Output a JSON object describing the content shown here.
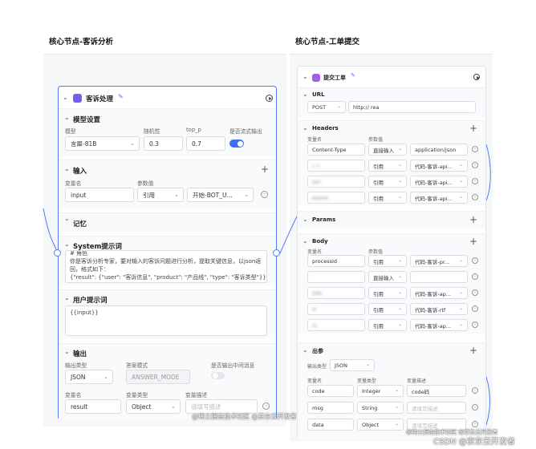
{
  "columns": {
    "left_title": "核心节点-客诉分析",
    "right_title": "核心节点-工单提交"
  },
  "left_node": {
    "title": "客诉处理",
    "model": {
      "section": "模型设置",
      "model_label": "模型",
      "model_value": "言犀-81B",
      "temp_label": "随机性",
      "temp_value": "0.3",
      "topp_label": "top_p",
      "topp_value": "0.7",
      "stream_label": "是否流式输出"
    },
    "input": {
      "section": "输入",
      "name_label": "变量名",
      "value_label": "参数值",
      "name": "input",
      "type": "引用",
      "ref": "开始-BOT_U..."
    },
    "memory": {
      "section": "记忆"
    },
    "system": {
      "section": "System提示词",
      "line1": "# 角色",
      "line2": "你是客诉分析专家，要对输入的客诉问题进行分析，提取关键信息，以json返回，格式如下：",
      "line3": "{\"result\": {\"user\": \"客诉",
      "line3b": "信息\", \"product\": \"产品线\", \"type\": \"客诉类型\"}}"
    },
    "user_prompt": {
      "section": "用户提示词",
      "value": "{{input}}"
    },
    "output": {
      "section": "输出",
      "type_label": "输出类型",
      "mode_label": "答案模式",
      "mid_label": "是否输出中间消息",
      "type_value": "JSON",
      "mode_value": "ANSWER_MODE",
      "name_label": "变量名",
      "vtype_label": "变量类型",
      "desc_label": "变量描述",
      "name": "result",
      "vtype": "Object",
      "desc_placeholder": "请填写描述"
    },
    "watermark": "@稀土掘金技术社区 @京东云开发者"
  },
  "right_node": {
    "title": "提交工单",
    "url": {
      "section": "URL",
      "method": "POST",
      "value": "http://                                     rea"
    },
    "headers": {
      "section": "Headers",
      "name_label": "变量名",
      "value_label": "参数值",
      "rows": [
        {
          "name": "Content-Type",
          "type": "直接输入",
          "value": "application/json"
        },
        {
          "name": "r,      t",
          "type": "引用",
          "value": "代码-客诉-api..."
        },
        {
          "name": "          tan",
          "type": "引用",
          "value": "代码-客诉-api..."
        },
        {
          "name": "         ession",
          "type": "引用",
          "value": "代码-客诉-api..."
        }
      ]
    },
    "params": {
      "section": "Params"
    },
    "body": {
      "section": "Body",
      "name_label": "变量名",
      "value_label": "参数值",
      "rows": [
        {
          "name": "processId",
          "type": "引用",
          "value": "代码-客诉-pr..."
        },
        {
          "name": "           ",
          "type": "直接输入",
          "value": "       "
        },
        {
          "name": "         Info",
          "type": "引用",
          "value": "代码-客诉-ap..."
        },
        {
          "name": "   rt",
          "type": "引用",
          "value": "代码-客诉-rtf"
        },
        {
          "name": "        rs",
          "type": "引用",
          "value": "代码-客诉-ap..."
        }
      ]
    },
    "output": {
      "section": "出参",
      "type_label": "输出类型",
      "type_value": "JSON",
      "name_label": "变量名",
      "vtype_label": "变量类型",
      "desc_label": "变量描述",
      "rows": [
        {
          "name": "code",
          "vtype": "Integer",
          "desc": "code码"
        },
        {
          "name": "msg",
          "vtype": "String",
          "desc": "请填写描述"
        },
        {
          "name": "data",
          "vtype": "Object",
          "desc": "请填写描述"
        }
      ]
    },
    "watermark": "@稀土掘金技术社区 @京东云开发者",
    "corner_watermark": "CSDN @京东云开发者"
  }
}
